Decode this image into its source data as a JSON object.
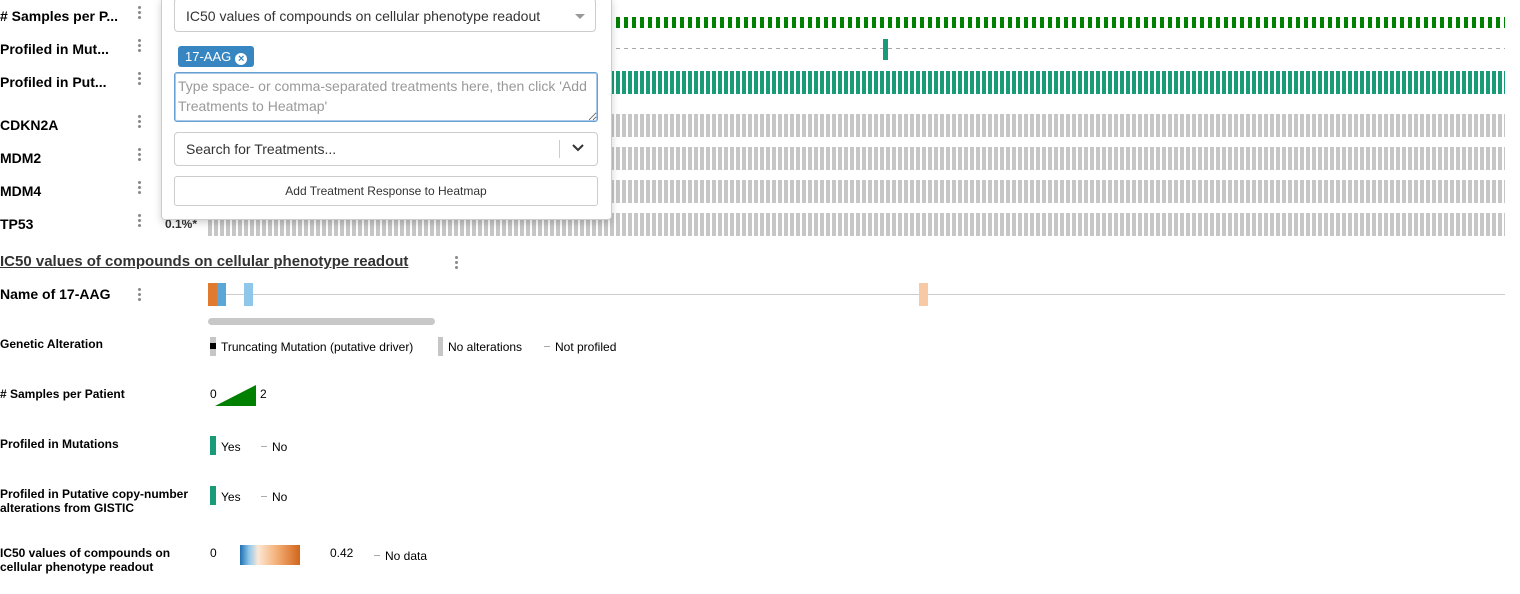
{
  "tracks": [
    {
      "label": "# Samples per P..."
    },
    {
      "label": "Profiled in Mut..."
    },
    {
      "label": "Profiled in Put..."
    },
    {
      "label": "CDKN2A"
    },
    {
      "label": "MDM2"
    },
    {
      "label": "MDM4"
    },
    {
      "label": "TP53",
      "percent": "0.1%*"
    }
  ],
  "popover": {
    "profile_select": "IC50 values of compounds on cellular phenotype readout",
    "chip_label": "17-AAG",
    "chip_remove_icon": "times-circle-icon",
    "textarea_placeholder": "Type space- or comma-separated treatments here, then click 'Add Treatments to Heatmap'",
    "search_placeholder": "Search for Treatments...",
    "add_button": "Add Treatment Response to Heatmap"
  },
  "heatmap": {
    "title": "IC50 values of compounds on cellular phenotype readout",
    "row_label": "Name of 17-AAG"
  },
  "legend": {
    "genetic_alteration": {
      "label": "Genetic Alteration",
      "truncating": "Truncating Mutation (putative driver)",
      "no_alterations": "No alterations",
      "not_profiled": "Not profiled"
    },
    "samples_per_patient": {
      "label": "# Samples per Patient",
      "min": "0",
      "max": "2"
    },
    "profiled_mutations": {
      "label": "Profiled in Mutations",
      "yes": "Yes",
      "no": "No"
    },
    "profiled_cna": {
      "label_line1": "Profiled in Putative copy-number",
      "label_line2": "alterations from GISTIC",
      "yes": "Yes",
      "no": "No"
    },
    "ic50": {
      "label_line1": "IC50 values of compounds on",
      "label_line2": "cellular phenotype readout",
      "min": "0",
      "max": "0.42",
      "no_data": "No data"
    }
  },
  "colors": {
    "samples_green": "#008000",
    "profiled_teal": "#1a9b78",
    "not_altered_gray": "#c6c6c6",
    "ic50_orange": "#e07a2e",
    "ic50_blue": "#3b87c4",
    "ic50_light_blue": "#8ec7ea",
    "ic50_peach": "#f7c9a5",
    "chip_blue": "#3786c2"
  }
}
